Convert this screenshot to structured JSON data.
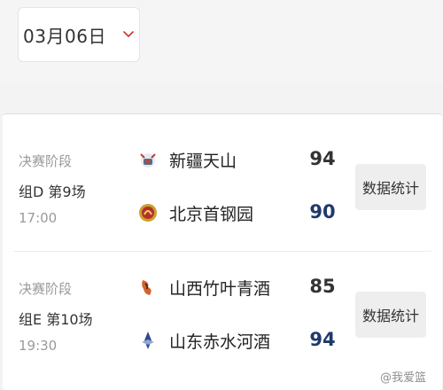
{
  "date_picker": {
    "value": "03月06日"
  },
  "matches": [
    {
      "stage": "决赛阶段",
      "group": "组D 第9场",
      "time": "17:00",
      "team1": {
        "name": "新疆天山",
        "score": "94",
        "logo": "xinjiang-logo"
      },
      "team2": {
        "name": "北京首钢园",
        "score": "90",
        "logo": "beijing-logo"
      },
      "stats_label": "数据统计"
    },
    {
      "stage": "决赛阶段",
      "group": "组E 第10场",
      "time": "19:30",
      "team1": {
        "name": "山西竹叶青酒",
        "score": "85",
        "logo": "shanxi-logo"
      },
      "team2": {
        "name": "山东赤水河酒",
        "score": "94",
        "logo": "shandong-logo"
      },
      "stats_label": "数据统计"
    }
  ],
  "watermark": "@我爱篮"
}
